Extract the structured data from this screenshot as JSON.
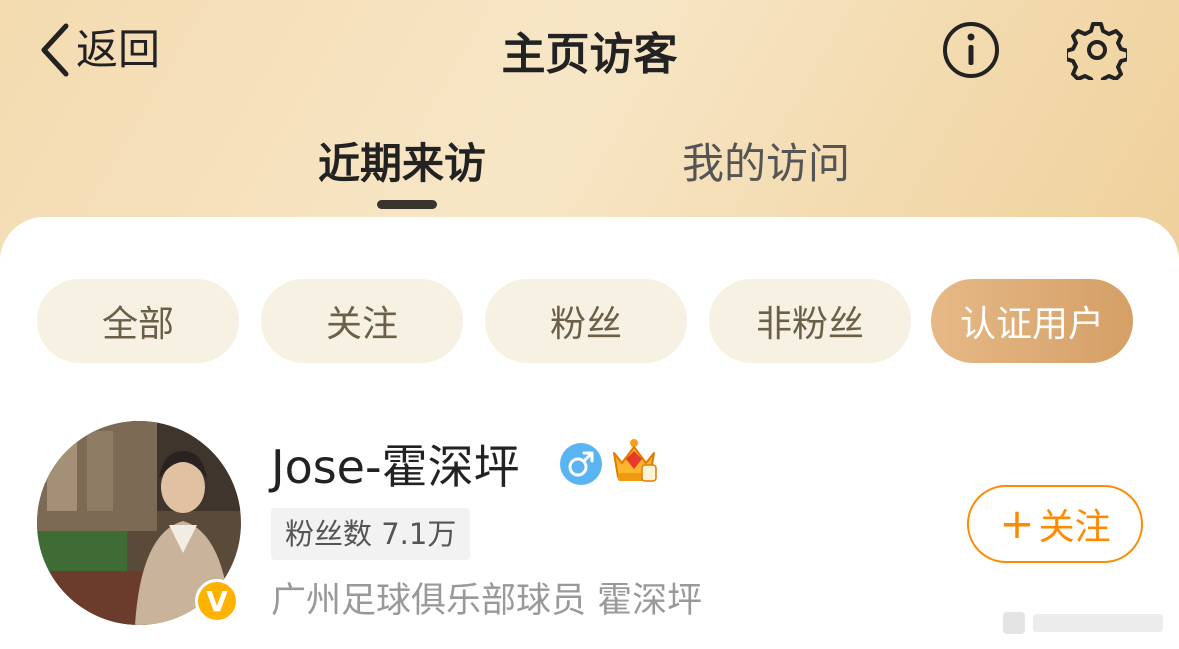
{
  "header": {
    "back_label": "返回",
    "title": "主页访客"
  },
  "tabs": [
    {
      "label": "近期来访",
      "active": true
    },
    {
      "label": "我的访问",
      "active": false
    }
  ],
  "filters": [
    {
      "label": "全部",
      "active": false
    },
    {
      "label": "关注",
      "active": false
    },
    {
      "label": "粉丝",
      "active": false
    },
    {
      "label": "非粉丝",
      "active": false
    },
    {
      "label": "认证用户",
      "active": true
    }
  ],
  "visitor": {
    "name": "Jose-霍深坪",
    "fans_label": "粉丝数 7.1万",
    "description": "广州足球俱乐部球员 霍深坪",
    "verified_badge": "V",
    "gender_symbol": "♂",
    "follow_plus": "+",
    "follow_label": "关注"
  },
  "colors": {
    "accent_orange": "#ff8a00",
    "active_chip": "#d9a46c",
    "chip_bg": "#f6f1e3",
    "gender_blue": "#5bb4f2",
    "verified_gold": "#ffb300"
  },
  "icons": {
    "back": "chevron-left-icon",
    "info": "info-icon",
    "settings": "gear-icon",
    "gender": "male-icon",
    "crown": "crown-icon",
    "verified": "verified-v-icon"
  }
}
